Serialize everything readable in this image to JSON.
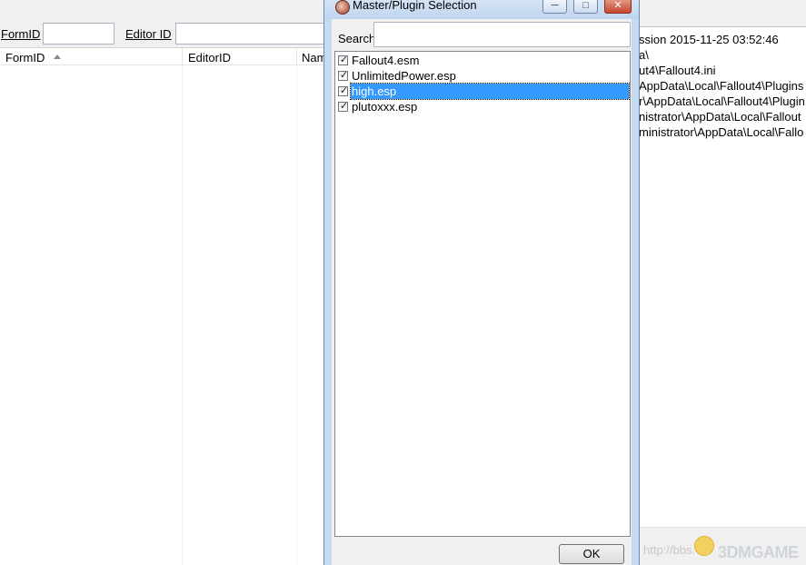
{
  "background_app": {
    "filters": {
      "formid_label": "FormID",
      "editorid_label": "Editor ID"
    },
    "columns": [
      "FormID",
      "EditorID",
      "Nam"
    ],
    "log_lines": [
      "ssion 2015-11-25 03:52:46",
      "a\\",
      "ut4\\Fallout4.ini",
      "AppData\\Local\\Fallout4\\Plugins",
      "r\\AppData\\Local\\Fallout4\\Plugin",
      "nistrator\\AppData\\Local\\Fallout",
      "ministrator\\AppData\\Local\\Fallo"
    ],
    "watermark": {
      "url": "http://bbs.",
      "logo": "3DMGAME"
    }
  },
  "dialog": {
    "title": "Master/Plugin Selection",
    "search_label": "Search",
    "search_value": "",
    "plugins": [
      {
        "label": "Fallout4.esm",
        "checked": true,
        "selected": false
      },
      {
        "label": "UnlimitedPower.esp",
        "checked": true,
        "selected": false
      },
      {
        "label": "high.esp",
        "checked": true,
        "selected": true
      },
      {
        "label": "plutoxxx.esp",
        "checked": true,
        "selected": false
      }
    ],
    "ok_label": "OK",
    "window_buttons": {
      "minimize": "─",
      "maximize": "□",
      "close": "✕"
    }
  },
  "colors": {
    "selection": "#3399ff",
    "title_bar": "#c5dbf2",
    "close_button": "#c4452c"
  }
}
